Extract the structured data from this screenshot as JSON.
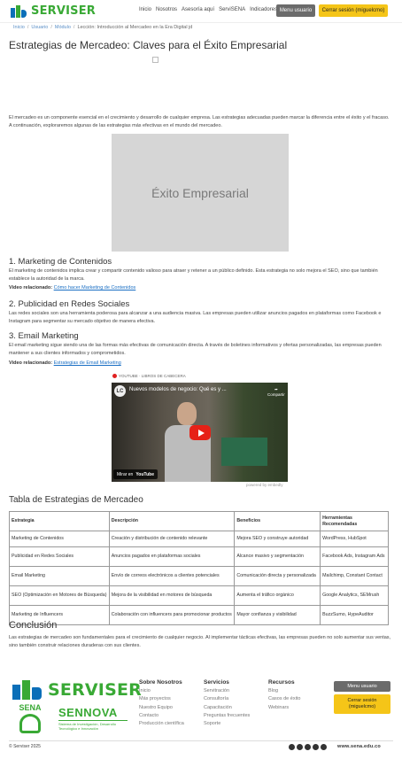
{
  "header": {
    "brand": "SERVISER",
    "nav": [
      "Inicio",
      "Nosotros",
      "Asesoría aquí",
      "ServiSENA",
      "Indicadores"
    ],
    "user_button": "Menu usuario",
    "logout_button": "Cerrar sesión (miguelcmo)"
  },
  "breadcrumb": {
    "items": [
      "Inicio",
      "Usuario",
      "Módulo"
    ],
    "current": "Lección: Introducción al Mercadeo en la Era Digital jd"
  },
  "article": {
    "title": "Estrategias de Mercadeo: Claves para el Éxito Empresarial",
    "intro": "El mercadeo es un componente esencial en el crecimiento y desarrollo de cualquier empresa. Las estrategias adecuadas pueden marcar la diferencia entre el éxito y el fracaso. A continuación, exploraremos algunas de las estrategias más efectivas en el mundo del mercadeo.",
    "hero_image_text": "Éxito Empresarial",
    "sections": [
      {
        "heading": "1. Marketing de Contenidos",
        "text": "El marketing de contenidos implica crear y compartir contenido valioso para atraer y retener a un público definido. Esta estrategia no solo mejora el SEO, sino que también establece la autoridad de la marca.",
        "video_label": "Video relacionado:",
        "video_link": "Cómo hacer Marketing de Contenidos"
      },
      {
        "heading": "2. Publicidad en Redes Sociales",
        "text": "Las redes sociales son una herramienta poderosa para alcanzar a una audiencia masiva. Las empresas pueden utilizar anuncios pagados en plataformas como Facebook e Instagram para segmentar su mercado objetivo de manera efectiva."
      },
      {
        "heading": "3. Email Marketing",
        "text": "El email marketing sigue siendo una de las formas más efectivas de comunicación directa. A través de boletines informativos y ofertas personalizadas, las empresas pueden mantener a sus clientes informados y comprometidos.",
        "video_label": "Video relacionado:",
        "video_link": "Estrategias de Email Marketing"
      }
    ],
    "video_embed": {
      "caption": "YOUTUBE · LIBROS DE CABECERA",
      "channel_initials": "LC",
      "title": "Nuevos modelos de negocio: Qué es y ...",
      "share_label": "Compartir",
      "watch_on": "Mirar en",
      "watch_on_brand": "YouTube",
      "powered_by": "powered by embedly"
    },
    "table_title": "Tabla de Estrategias de Mercadeo",
    "table": {
      "headers": [
        "Estrategia",
        "Descripción",
        "Beneficios",
        "Herramientas Recomendadas"
      ],
      "rows": [
        [
          "Marketing de Contenidos",
          "Creación y distribución de contenido relevante",
          "Mejora SEO y construye autoridad",
          "WordPress, HubSpot"
        ],
        [
          "Publicidad en Redes Sociales",
          "Anuncios pagados en plataformas sociales",
          "Alcance masivo y segmentación",
          "Facebook Ads, Instagram Ads"
        ],
        [
          "Email Marketing",
          "Envío de correos electrónicos a clientes potenciales",
          "Comunicación directa y personalizada",
          "Mailchimp, Constant Contact"
        ],
        [
          "SEO (Optimización en Motores de Búsqueda)",
          "Mejora de la visibilidad en motores de búsqueda",
          "Aumenta el tráfico orgánico",
          "Google Analytics, SEMrush"
        ],
        [
          "Marketing de Influencers",
          "Colaboración con influencers para promocionar productos",
          "Mayor confianza y visibilidad",
          "BuzzSumo, HypeAuditor"
        ]
      ]
    },
    "conclusion_title": "Conclusión",
    "conclusion_text": "Las estrategias de mercadeo son fundamentales para el crecimiento de cualquier negocio. Al implementar tácticas efectivas, las empresas pueden no solo aumentar sus ventas, sino también construir relaciones duraderas con sus clientes."
  },
  "footer": {
    "brand": "SERVISER",
    "sena": "SENA",
    "sennova": "SENNOVA",
    "sennova_sub": "Sistema de Investigación, Desarrollo Tecnológico e Innovación",
    "columns": [
      {
        "title": "Sobre Nosotros",
        "items": [
          "Inicio",
          "Más proyectos",
          "Nuestro Equipo",
          "Contacto",
          "Producción científica"
        ]
      },
      {
        "title": "Servicios",
        "items": [
          "Servitración",
          "Consultoría",
          "Capacitación",
          "Preguntas frecuentes",
          "Soporte"
        ]
      },
      {
        "title": "Recursos",
        "items": [
          "Blog",
          "Casos de éxito",
          "Webinars"
        ]
      }
    ],
    "user_button": "Menu usuario",
    "logout_button": "Cerrar sesión (miguelcmo)",
    "copyright": "© Serviser 2025",
    "social_icons": [
      "instagram-icon",
      "facebook-icon",
      "twitter-icon",
      "youtube-icon",
      "linkedin-icon"
    ],
    "domain": "www.sena.edu.co"
  }
}
